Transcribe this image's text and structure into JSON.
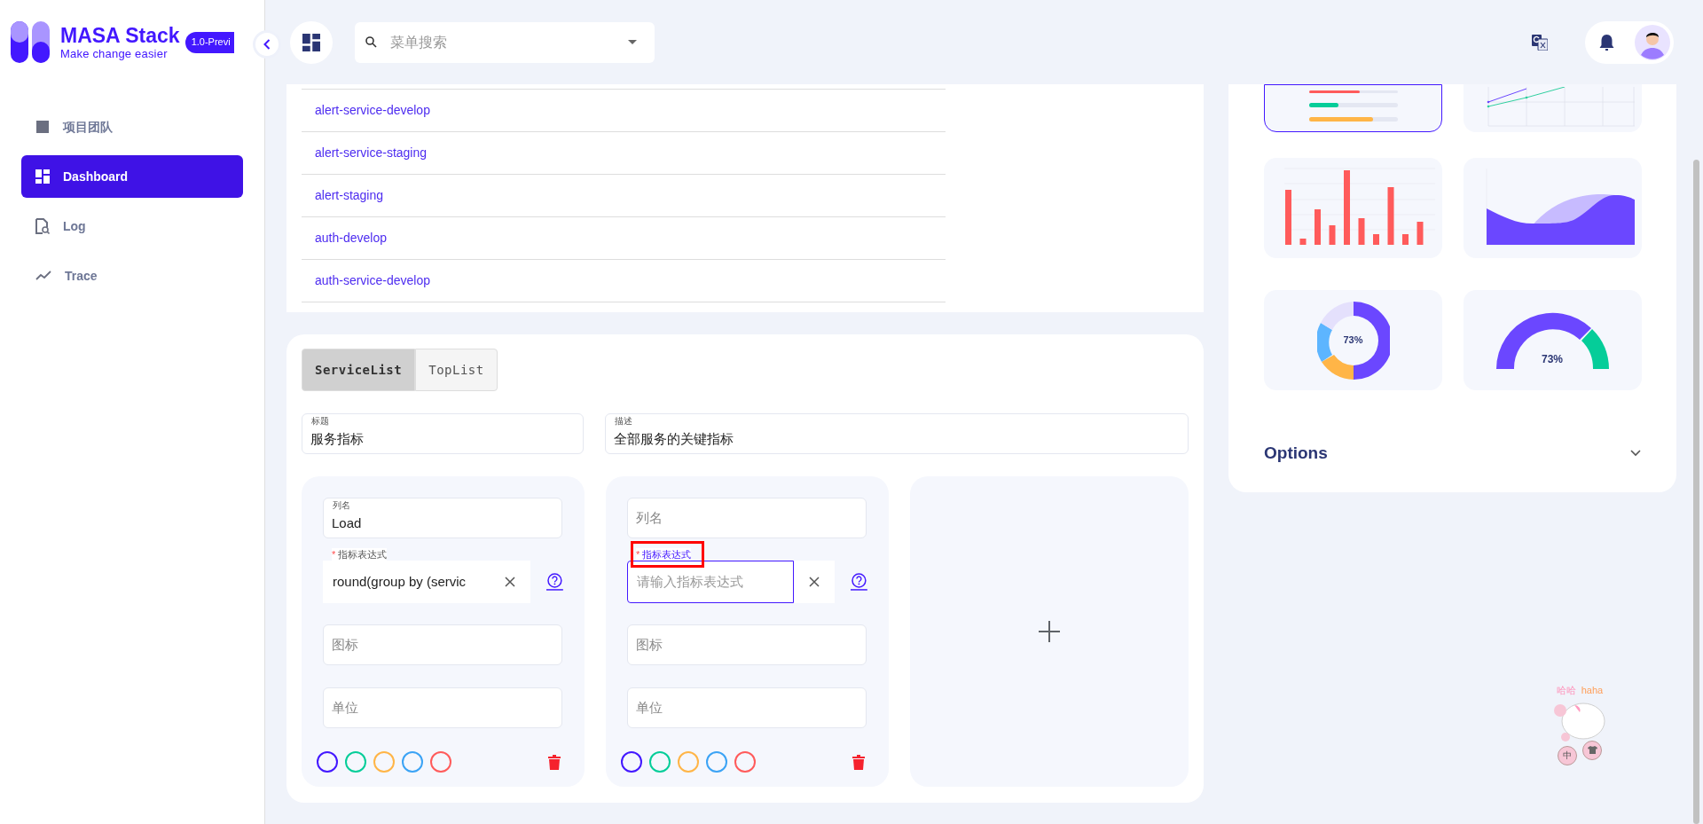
{
  "sidebar": {
    "logo": {
      "title": "MASA Stack",
      "tagline": "Make change easier"
    },
    "version_badge": "1.0-Previ",
    "items": [
      {
        "label": "项目团队",
        "kind": "team",
        "selected": false
      },
      {
        "label": "Dashboard",
        "kind": "dashboard",
        "selected": true
      },
      {
        "label": "Log",
        "kind": "log",
        "selected": false
      },
      {
        "label": "Trace",
        "kind": "trace",
        "selected": false
      }
    ]
  },
  "header": {
    "search": {
      "placeholder": "菜单搜索"
    }
  },
  "service_table": {
    "rows": [
      "alert-service-develop",
      "alert-service-staging",
      "alert-staging",
      "auth-develop",
      "auth-service-develop"
    ]
  },
  "editor": {
    "tabs": [
      {
        "label": "ServiceList",
        "selected": true
      },
      {
        "label": "TopList",
        "selected": false
      }
    ],
    "title_field": {
      "label": "标题",
      "value": "服务指标"
    },
    "description_field": {
      "label": "描述",
      "value": "全部服务的关键指标"
    },
    "columns": [
      {
        "name_field": {
          "label": "列名",
          "value": "Load"
        },
        "expression_field": {
          "label": "指标表达式",
          "required_mark": "*",
          "value": "round(group by (servic",
          "focused": false,
          "highlighted": false
        },
        "icon_field": {
          "placeholder": "图标"
        },
        "unit_field": {
          "placeholder": "单位"
        },
        "colors": [
          {
            "color": "#4318ff"
          },
          {
            "color": "#05cd99"
          },
          {
            "color": "#ffb547"
          },
          {
            "color": "#3ba3f5"
          },
          {
            "color": "#ff5b5b"
          }
        ]
      },
      {
        "name_field": {
          "placeholder": "列名"
        },
        "expression_field": {
          "label": "指标表达式",
          "required_mark": "*",
          "placeholder": "请输入指标表达式",
          "focused": true,
          "highlighted": true
        },
        "icon_field": {
          "placeholder": "图标"
        },
        "unit_field": {
          "placeholder": "单位"
        },
        "colors": [
          {
            "color": "#4318ff"
          },
          {
            "color": "#05cd99"
          },
          {
            "color": "#ffb547"
          },
          {
            "color": "#3ba3f5"
          },
          {
            "color": "#ff5b5b"
          }
        ]
      }
    ]
  },
  "widgets": [
    {
      "kind": "progress",
      "selected": true
    },
    {
      "kind": "line",
      "selected": false
    },
    {
      "kind": "bar",
      "selected": false
    },
    {
      "kind": "area",
      "selected": false
    },
    {
      "kind": "donut",
      "selected": false,
      "label": "73%"
    },
    {
      "kind": "gauge",
      "selected": false,
      "label": "73%"
    }
  ],
  "options": {
    "title": "Options",
    "expanded": false
  },
  "mascot": {
    "caption_cn": "哈哈",
    "caption_en": "haha",
    "button": "中"
  }
}
